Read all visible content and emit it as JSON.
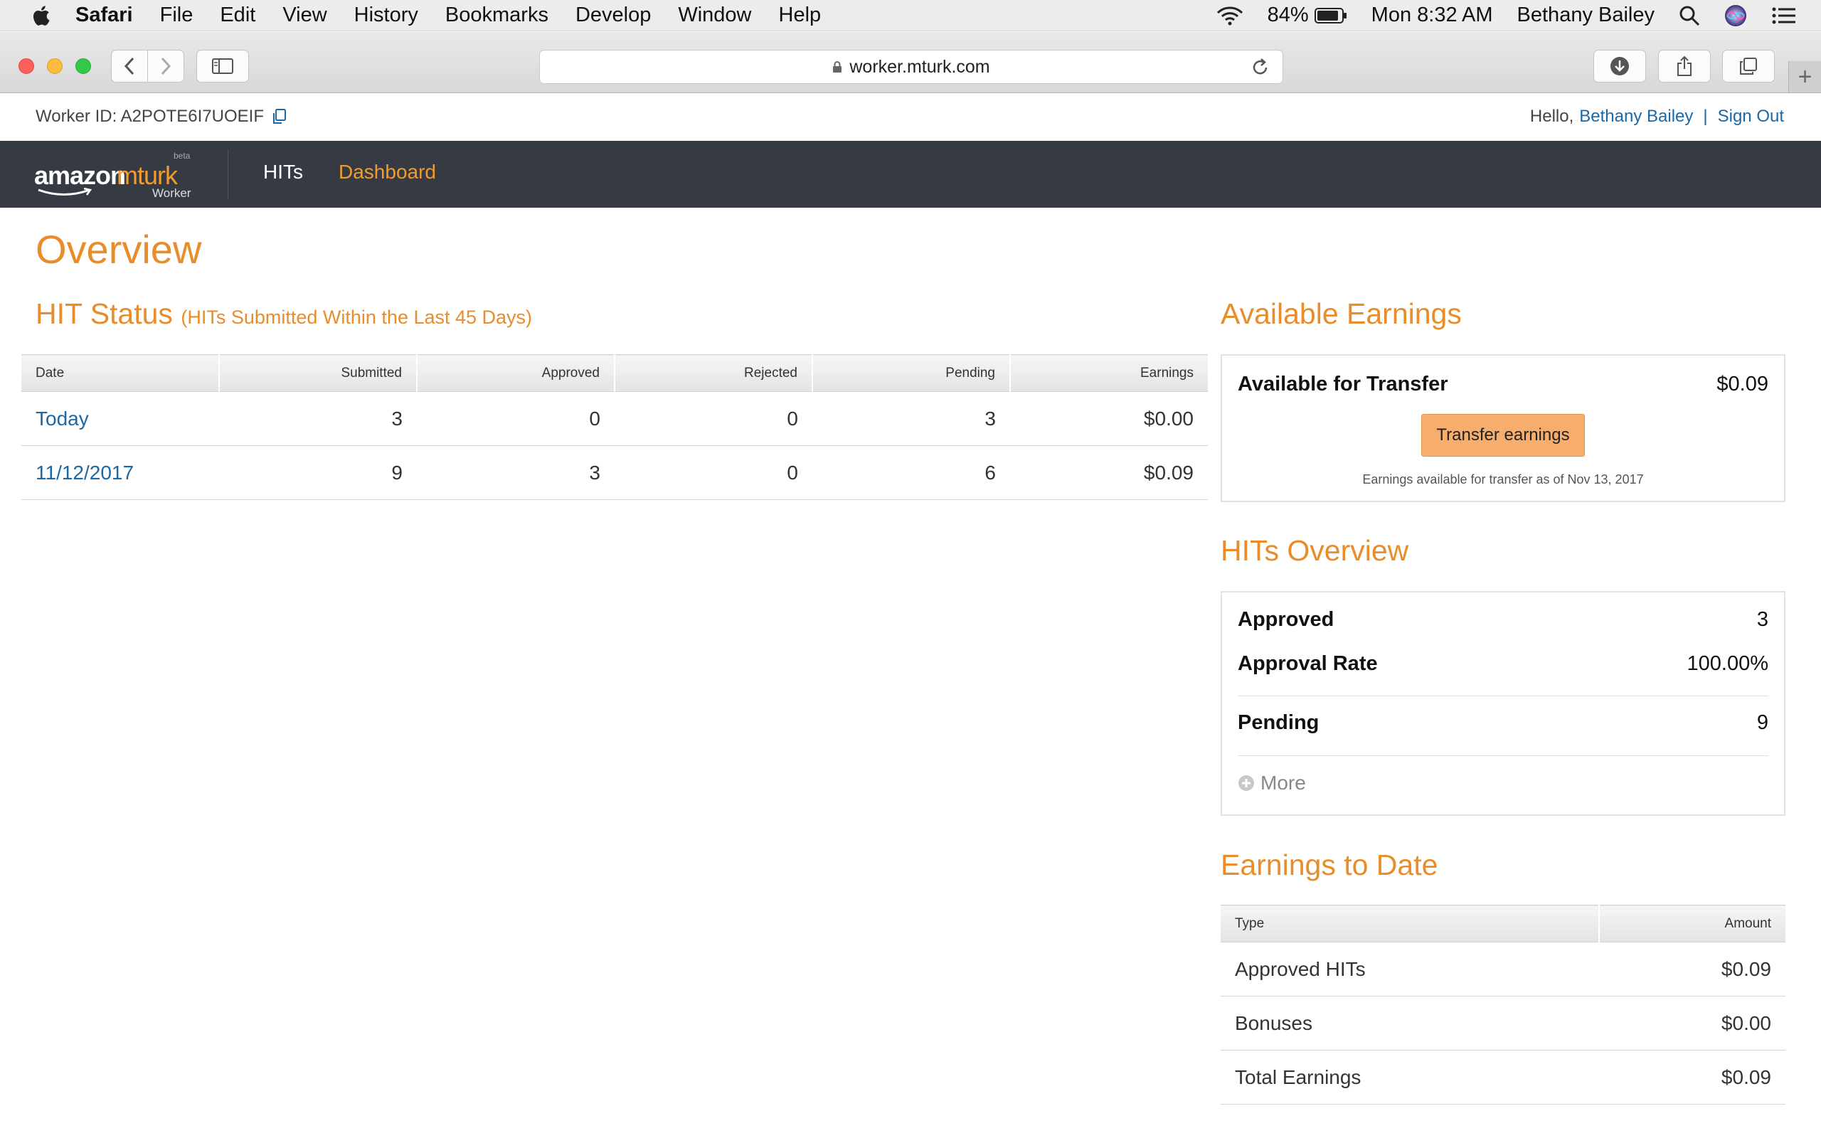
{
  "menubar": {
    "app_name": "Safari",
    "items": [
      "File",
      "Edit",
      "View",
      "History",
      "Bookmarks",
      "Develop",
      "Window",
      "Help"
    ],
    "battery": "84%",
    "clock": "Mon 8:32 AM",
    "user": "Bethany Bailey"
  },
  "browser": {
    "url": "worker.mturk.com"
  },
  "account": {
    "worker_id_label": "Worker ID: A2POTE6I7UOEIF",
    "hello": "Hello,",
    "user_name": "Bethany Bailey",
    "sign_out": "Sign Out"
  },
  "nav": {
    "logo_word1": "amazon",
    "logo_word2": "mturk",
    "logo_beta": "beta",
    "logo_sub": "Worker",
    "hits": "HITs",
    "dashboard": "Dashboard"
  },
  "page": {
    "title": "Overview"
  },
  "hit_status": {
    "title": "HIT Status",
    "subtitle": "(HITs Submitted Within the Last 45 Days)",
    "columns": [
      "Date",
      "Submitted",
      "Approved",
      "Rejected",
      "Pending",
      "Earnings"
    ],
    "rows": [
      [
        "Today",
        "3",
        "0",
        "0",
        "3",
        "$0.00"
      ],
      [
        "11/12/2017",
        "9",
        "3",
        "0",
        "6",
        "$0.09"
      ]
    ]
  },
  "available_earnings": {
    "title": "Available Earnings",
    "label": "Available for Transfer",
    "amount": "$0.09",
    "button": "Transfer earnings",
    "note": "Earnings available for transfer as of Nov 13, 2017"
  },
  "hits_overview": {
    "title": "HITs Overview",
    "approved_label": "Approved",
    "approved_value": "3",
    "rate_label": "Approval Rate",
    "rate_value": "100.00%",
    "pending_label": "Pending",
    "pending_value": "9",
    "more": "More"
  },
  "earnings_to_date": {
    "title": "Earnings to Date",
    "columns": [
      "Type",
      "Amount"
    ],
    "rows": [
      [
        "Approved HITs",
        "$0.09"
      ],
      [
        "Bonuses",
        "$0.00"
      ],
      [
        "Total Earnings",
        "$0.09"
      ]
    ]
  },
  "colors": {
    "accent": "#e88d2a",
    "link": "#1a69a6",
    "nav_bg": "#353a43",
    "button": "#f7ad6b"
  }
}
